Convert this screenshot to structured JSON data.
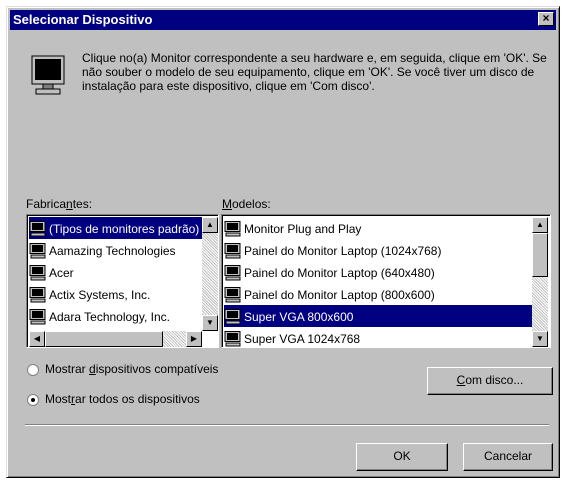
{
  "window": {
    "title": "Selecionar Dispositivo",
    "close_glyph": "×"
  },
  "instructions": "Clique no(a) Monitor correspondente a seu hardware e, em seguida, clique em 'OK'. Se não souber o modelo de seu equipamento, clique em 'OK'. Se você tiver um disco de instalação para este dispositivo, clique em 'Com disco'.",
  "manufacturers": {
    "label_pre": "Fabrica",
    "label_accel": "n",
    "label_post": "tes:",
    "items": [
      {
        "label": "(Tipos de monitores padrão)"
      },
      {
        "label": "Aamazing Technologies"
      },
      {
        "label": "Acer"
      },
      {
        "label": "Actix Systems, Inc."
      },
      {
        "label": "Adara Technology, Inc."
      }
    ],
    "selected_index": 0
  },
  "models": {
    "label_accel": "M",
    "label_post": "odelos:",
    "items": [
      {
        "label": "Monitor Plug and Play"
      },
      {
        "label": "Painel do Monitor Laptop (1024x768)"
      },
      {
        "label": "Painel do Monitor Laptop (640x480)"
      },
      {
        "label": "Painel do Monitor Laptop (800x600)"
      },
      {
        "label": "Super VGA  800x600"
      },
      {
        "label": "Super VGA 1024x768"
      }
    ],
    "selected_index": 4
  },
  "options": {
    "compatible": {
      "pre": "Mostrar ",
      "accel": "d",
      "post": "ispositivos compatíveis",
      "checked": false
    },
    "all": {
      "pre": "Most",
      "accel": "r",
      "post": "ar todos os dispositivos",
      "checked": true
    }
  },
  "buttons": {
    "have_disk": {
      "accel": "C",
      "post": "om disco..."
    },
    "ok": "OK",
    "cancel": "Cancelar"
  },
  "icons": {
    "header": "monitor-icon",
    "list_item": "monitor-icon"
  }
}
